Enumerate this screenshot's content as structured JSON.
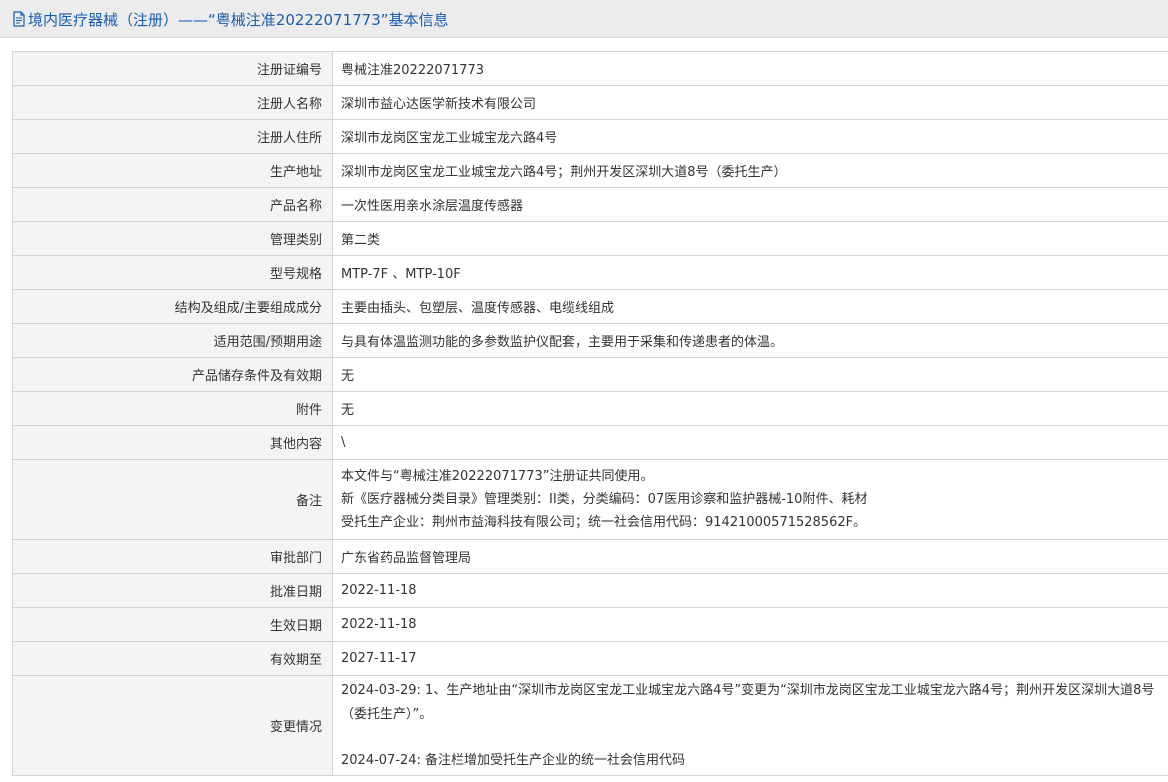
{
  "header": {
    "icon": "document-icon",
    "accent_color": "#1a5db0",
    "title": "境内医疗器械（注册）——“粤械注准20222071773”基本信息"
  },
  "table": {
    "rows": [
      {
        "label": "注册证编号",
        "value": "粤械注准20222071773"
      },
      {
        "label": "注册人名称",
        "value": "深圳市益心达医学新技术有限公司"
      },
      {
        "label": "注册人住所",
        "value": "深圳市龙岗区宝龙工业城宝龙六路4号"
      },
      {
        "label": "生产地址",
        "value": "深圳市龙岗区宝龙工业城宝龙六路4号；荆州开发区深圳大道8号（委托生产）"
      },
      {
        "label": "产品名称",
        "value": "一次性医用亲水涂层温度传感器"
      },
      {
        "label": "管理类别",
        "value": "第二类"
      },
      {
        "label": "型号规格",
        "value": "MTP-7F 、MTP-10F"
      },
      {
        "label": "结构及组成/主要组成成分",
        "value": "主要由插头、包塑层、温度传感器、电缆线组成"
      },
      {
        "label": "适用范围/预期用途",
        "value": "与具有体温监测功能的多参数监护仪配套，主要用于采集和传递患者的体温。"
      },
      {
        "label": "产品储存条件及有效期",
        "value": "无"
      },
      {
        "label": "附件",
        "value": "无"
      },
      {
        "label": "其他内容",
        "value": "\\"
      }
    ],
    "notes": {
      "label": "备注",
      "lines": [
        "本文件与“粤械注准20222071773”注册证共同使用。",
        "新《医疗器械分类目录》管理类别：II类，分类编码：07医用诊察和监护器械-10附件、耗材",
        "受托生产企业：荆州市益海科技有限公司；统一社会信用代码：91421000571528562F。"
      ]
    },
    "rows2": [
      {
        "label": "审批部门",
        "value": "广东省药品监督管理局"
      },
      {
        "label": "批准日期",
        "value": "2022-11-18"
      },
      {
        "label": "生效日期",
        "value": "2022-11-18"
      },
      {
        "label": "有效期至",
        "value": "2027-11-17"
      }
    ],
    "changes": {
      "label": "变更情况",
      "entries": [
        "2024-03-29: 1、生产地址由“深圳市龙岗区宝龙工业城宝龙六路4号”变更为“深圳市龙岗区宝龙工业城宝龙六路4号；荆州开发区深圳大道8号（委托生产）”。",
        "2024-07-24: 备注栏增加受托生产企业的统一社会信用代码"
      ]
    }
  }
}
